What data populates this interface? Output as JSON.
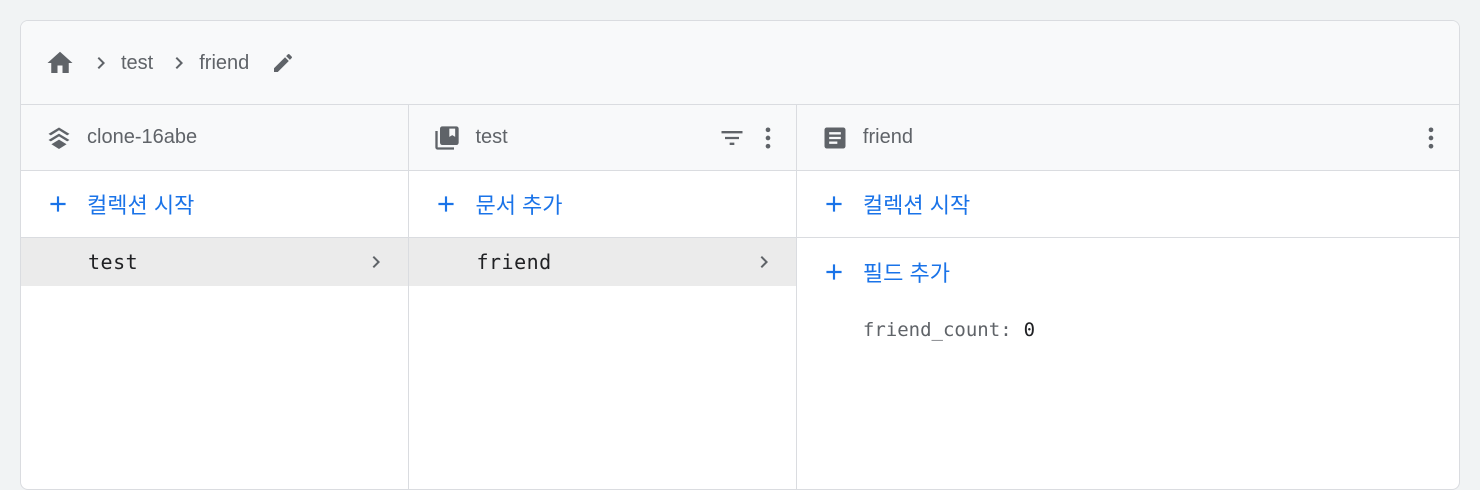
{
  "breadcrumb": {
    "home_icon": "home-icon",
    "items": [
      "test",
      "friend"
    ],
    "edit_icon": "pencil-icon"
  },
  "columns": {
    "project": {
      "icon": "firestore-stack-icon",
      "title": "clone-16abe",
      "add_label": "컬렉션 시작",
      "items": [
        {
          "label": "test",
          "selected": true
        }
      ]
    },
    "collection": {
      "icon": "collection-icon",
      "title": "test",
      "filter_icon": "filter-icon",
      "menu_icon": "more-vert-icon",
      "add_label": "문서 추가",
      "items": [
        {
          "label": "friend",
          "selected": true
        }
      ]
    },
    "document": {
      "icon": "document-icon",
      "title": "friend",
      "menu_icon": "more-vert-icon",
      "add_collection_label": "컬렉션 시작",
      "add_field_label": "필드 추가",
      "fields": [
        {
          "key": "friend_count:",
          "value": "0"
        }
      ]
    }
  },
  "colors": {
    "accent": "#1a73e8",
    "selected_bg": "#ebebeb",
    "header_bg": "#f8f9fa",
    "icon_gray": "#5f6368"
  }
}
